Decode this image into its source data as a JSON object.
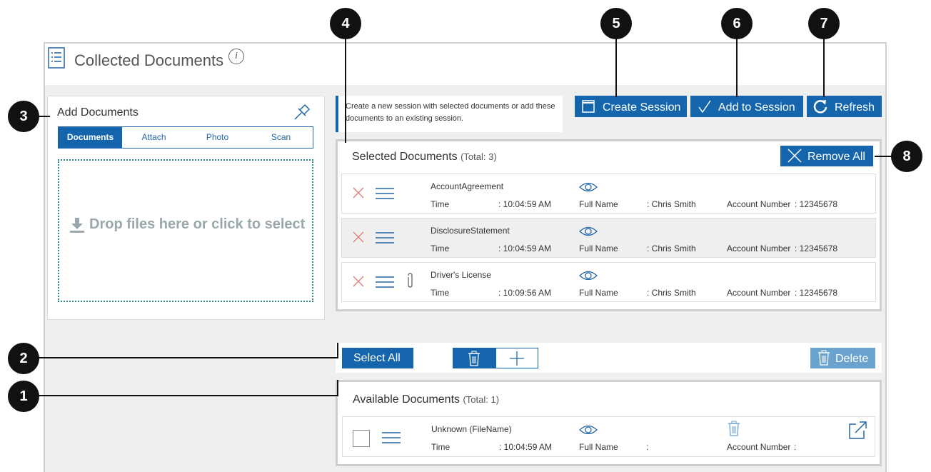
{
  "header": {
    "title": "Collected Documents",
    "info": "i"
  },
  "markers": [
    "1",
    "2",
    "3",
    "4",
    "5",
    "6",
    "7",
    "8"
  ],
  "add_panel": {
    "title": "Add Documents",
    "tabs": [
      "Documents",
      "Attach",
      "Photo",
      "Scan"
    ],
    "active_tab": "Documents",
    "dropzone": "Drop files here or click to select"
  },
  "note": "Create a new session with selected documents or add these documents to an existing session.",
  "actions": {
    "create": "Create Session",
    "add": "Add to Session",
    "refresh": "Refresh"
  },
  "selected": {
    "title": "Selected Documents",
    "total": "(Total: 3)",
    "remove_all": "Remove All",
    "labels": {
      "time": "Time",
      "full_name": "Full Name",
      "account": "Account Number"
    },
    "rows": [
      {
        "name": "AccountAgreement",
        "time": ": 10:04:59 AM",
        "full_name": ": Chris Smith",
        "account": ": 12345678"
      },
      {
        "name": "DisclosureStatement",
        "time": ": 10:04:59 AM",
        "full_name": ": Chris Smith",
        "account": ": 12345678"
      },
      {
        "name": "Driver's License",
        "time": ": 10:09:56 AM",
        "full_name": ": Chris Smith",
        "account": ": 12345678"
      }
    ]
  },
  "toolbar": {
    "select_all": "Select All",
    "delete": "Delete"
  },
  "available": {
    "title": "Available Documents",
    "total": "(Total: 1)",
    "rows": [
      {
        "name": "Unknown (FileName)",
        "time": ": 10:04:59 AM",
        "full_name": ":",
        "account": ":"
      }
    ]
  },
  "colors": {
    "primary": "#1565ad",
    "delete_disabled": "#6ba3cf",
    "remove_x": "#e07a7a"
  }
}
